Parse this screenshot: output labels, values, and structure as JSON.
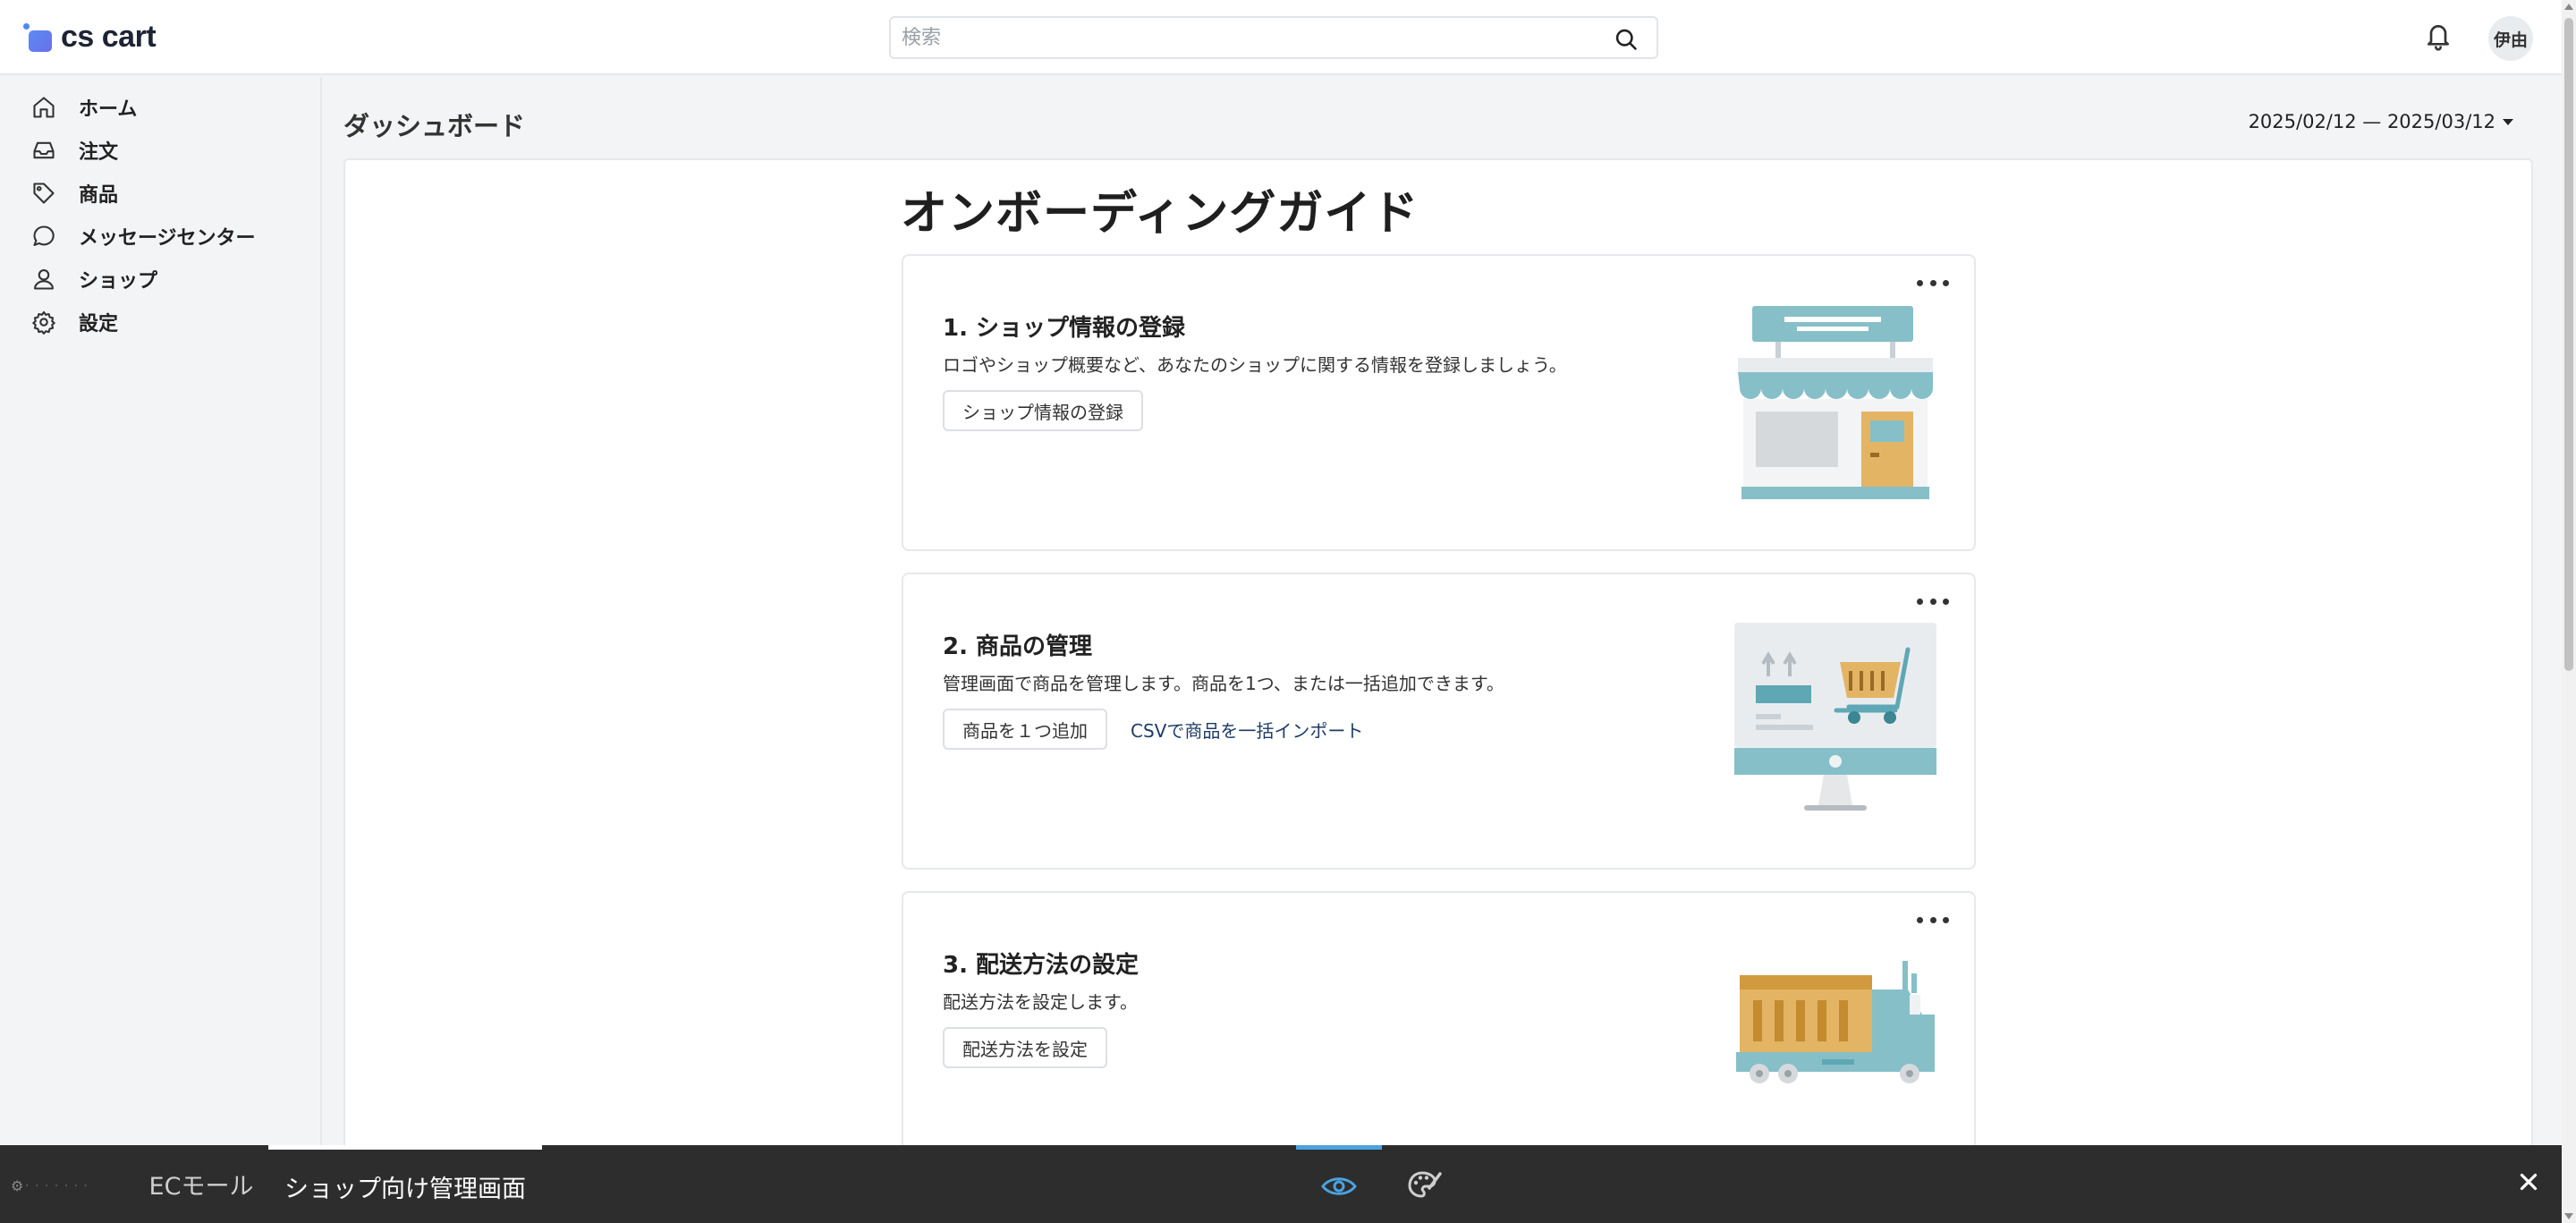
{
  "header": {
    "logo_text": "cs cart",
    "search_placeholder": "検索",
    "avatar_text": "伊由"
  },
  "sidebar": {
    "items": [
      {
        "label": "ホーム",
        "icon": "home-icon"
      },
      {
        "label": "注文",
        "icon": "inbox-icon"
      },
      {
        "label": "商品",
        "icon": "tag-icon"
      },
      {
        "label": "メッセージセンター",
        "icon": "chat-icon"
      },
      {
        "label": "ショップ",
        "icon": "user-icon"
      },
      {
        "label": "設定",
        "icon": "gear-icon"
      }
    ]
  },
  "main": {
    "page_title": "ダッシュボード",
    "date_range": "2025/02/12 — 2025/03/12",
    "guide_title": "オンボーディングガイド",
    "cards": [
      {
        "title": "1. ショップ情報の登録",
        "desc": "ロゴやショップ概要など、あなたのショップに関する情報を登録しましょう。",
        "button": "ショップ情報の登録"
      },
      {
        "title": "2. 商品の管理",
        "desc": "管理画面で商品を管理します。商品を1つ、または一括追加できます。",
        "button": "商品を１つ追加",
        "link": "CSVで商品を一括インポート"
      },
      {
        "title": "3. 配送方法の設定",
        "desc": "配送方法を設定します。",
        "button": "配送方法を設定"
      }
    ]
  },
  "bottom_bar": {
    "tab_ec_mall": "ECモール",
    "tab_shop_admin": "ショップ向け管理画面",
    "active_tab": "ショップ向け管理画面",
    "accent_color": "#4aa3df"
  }
}
